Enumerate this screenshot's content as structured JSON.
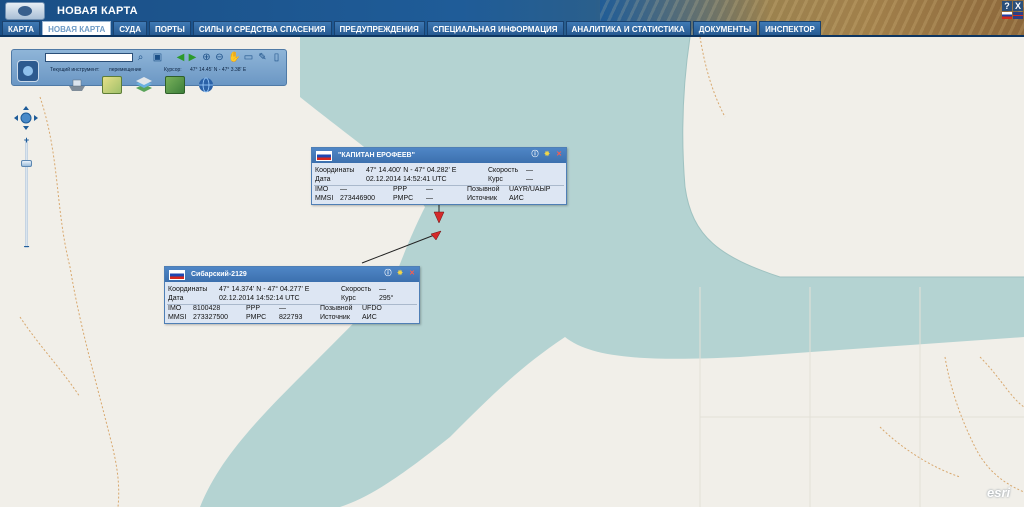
{
  "app": {
    "title": "НОВАЯ КАРТА"
  },
  "header": {
    "help": "?",
    "close": "X"
  },
  "tabs": [
    {
      "label": "КАРТА",
      "active": false
    },
    {
      "label": "НОВАЯ КАРТА",
      "active": true
    },
    {
      "label": "СУДА",
      "active": false
    },
    {
      "label": "ПОРТЫ",
      "active": false
    },
    {
      "label": "СИЛЫ И СРЕДСТВА СПАСЕНИЯ",
      "active": false
    },
    {
      "label": "ПРЕДУПРЕЖДЕНИЯ",
      "active": false
    },
    {
      "label": "СПЕЦИАЛЬНАЯ ИНФОРМАЦИЯ",
      "active": false
    },
    {
      "label": "АНАЛИТИКА И СТАТИСТИКА",
      "active": false
    },
    {
      "label": "ДОКУМЕНТЫ",
      "active": false
    },
    {
      "label": "ИНСПЕКТОР",
      "active": false
    }
  ],
  "toolbar": {
    "search_value": "",
    "tool_label": "Текущий инструмент:",
    "tool_value": "перемещение",
    "cursor_label": "Курсор:",
    "cursor_value": "47° 14.45' N - 47° 3.38' E",
    "icons": [
      "search-icon",
      "bookmark-icon",
      "arrow-left-icon",
      "arrow-right-icon",
      "zoom-in-icon",
      "zoom-out-icon",
      "pan-hand-icon",
      "ruler-icon",
      "pencil-icon",
      "clear-icon"
    ]
  },
  "zoom": {
    "plus": "+",
    "minus": "−",
    "level_fraction": 0.2
  },
  "vessels": [
    {
      "name": "\"КАПИТАН ЕРОФЕЕВ\"",
      "coords_label": "Координаты",
      "coords": "47° 14.400' N - 47° 04.282' E",
      "date_label": "Дата",
      "date": "02.12.2014 14:52:41 UTC",
      "imo_label": "IMO",
      "imo": "—",
      "mmsi_label": "MMSI",
      "mmsi": "273446900",
      "ppp_label": "PPP",
      "ppp": "—",
      "pmpc_label": "PMPC",
      "pmpc": "—",
      "speed_label": "Скорость",
      "speed": "—",
      "course_label": "Курс",
      "course": "—",
      "callsign_label": "Позывной",
      "callsign": "UAYR/UAЫР",
      "source_label": "Источник",
      "source": "АИС"
    },
    {
      "name": "Сибарский-2129",
      "coords_label": "Координаты",
      "coords": "47° 14.374' N - 47° 04.277' E",
      "date_label": "Дата",
      "date": "02.12.2014 14:52:14 UTC",
      "imo_label": "IMO",
      "imo": "8100428",
      "mmsi_label": "MMSI",
      "mmsi": "273327500",
      "ppp_label": "PPP",
      "ppp": "—",
      "pmpc_label": "PMPC",
      "pmpc": "822793",
      "speed_label": "Скорость",
      "speed": "—",
      "course_label": "Курс",
      "course": "295°",
      "callsign_label": "Позывной",
      "callsign": "UFDO",
      "source_label": "Источник",
      "source": "АИС"
    }
  ],
  "colors": {
    "water": "#b4d3d2",
    "land": "#f1efe9",
    "header": "#1f5c98",
    "popup_title": "#4379b8",
    "vessel_marker": "#d42a2a"
  },
  "attribution": "esri"
}
